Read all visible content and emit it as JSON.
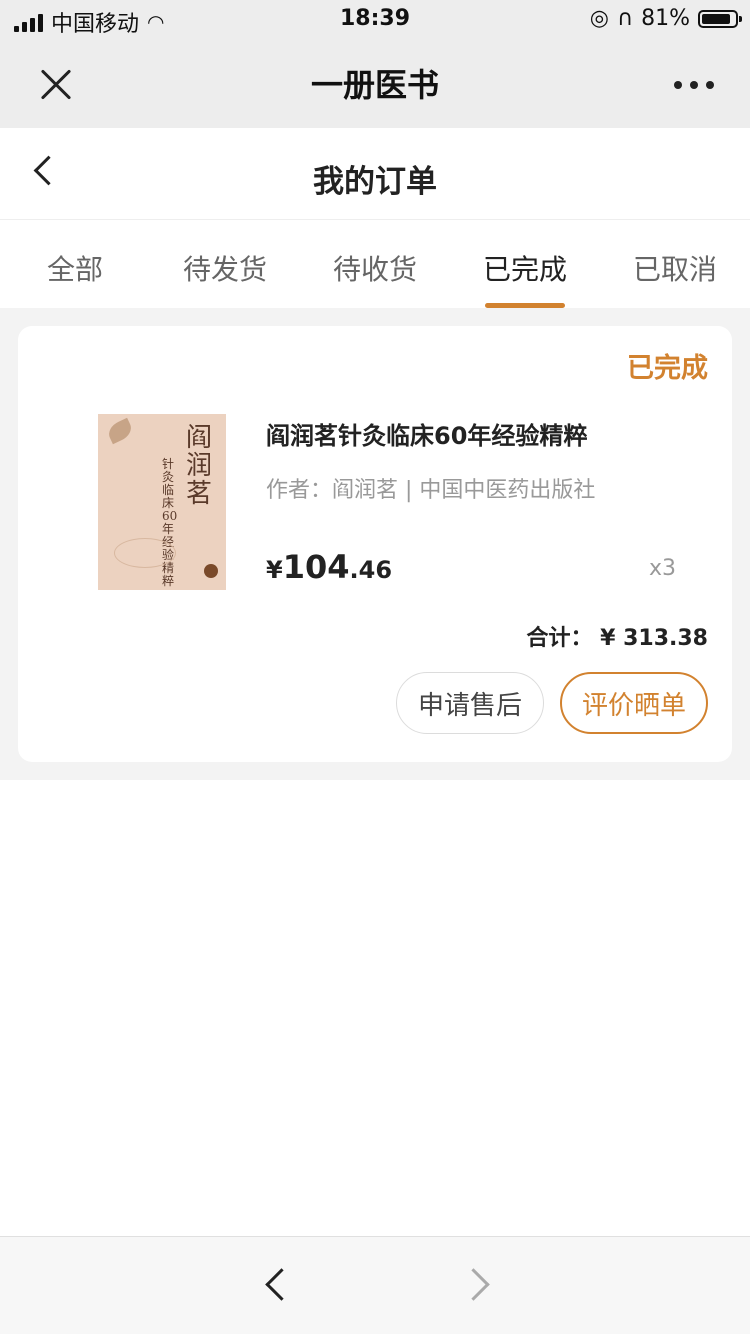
{
  "status_bar": {
    "carrier": "中国移动",
    "time": "18:39",
    "battery": "81%"
  },
  "wechat_header": {
    "title": "一册医书"
  },
  "page": {
    "title": "我的订单"
  },
  "tabs": [
    {
      "label": "全部"
    },
    {
      "label": "待发货"
    },
    {
      "label": "待收货"
    },
    {
      "label": "已完成",
      "active": true
    },
    {
      "label": "已取消"
    }
  ],
  "order": {
    "status": "已完成",
    "cover": {
      "title_text": "阎润茗",
      "subtitle_text": "针灸临床60年经验精粹"
    },
    "product_title": "阎润茗针灸临床60年经验精粹",
    "meta": "作者：阎润茗 | 中国中医药出版社",
    "price_currency": "¥",
    "price_int": "104",
    "price_decimal": ".46",
    "quantity": "x3",
    "total": "合计： ¥ 313.38",
    "buttons": {
      "after_sale": "申请售后",
      "review": "评价晒单"
    }
  },
  "colors": {
    "accent": "#d2822f",
    "background": "#f3f3f3"
  }
}
